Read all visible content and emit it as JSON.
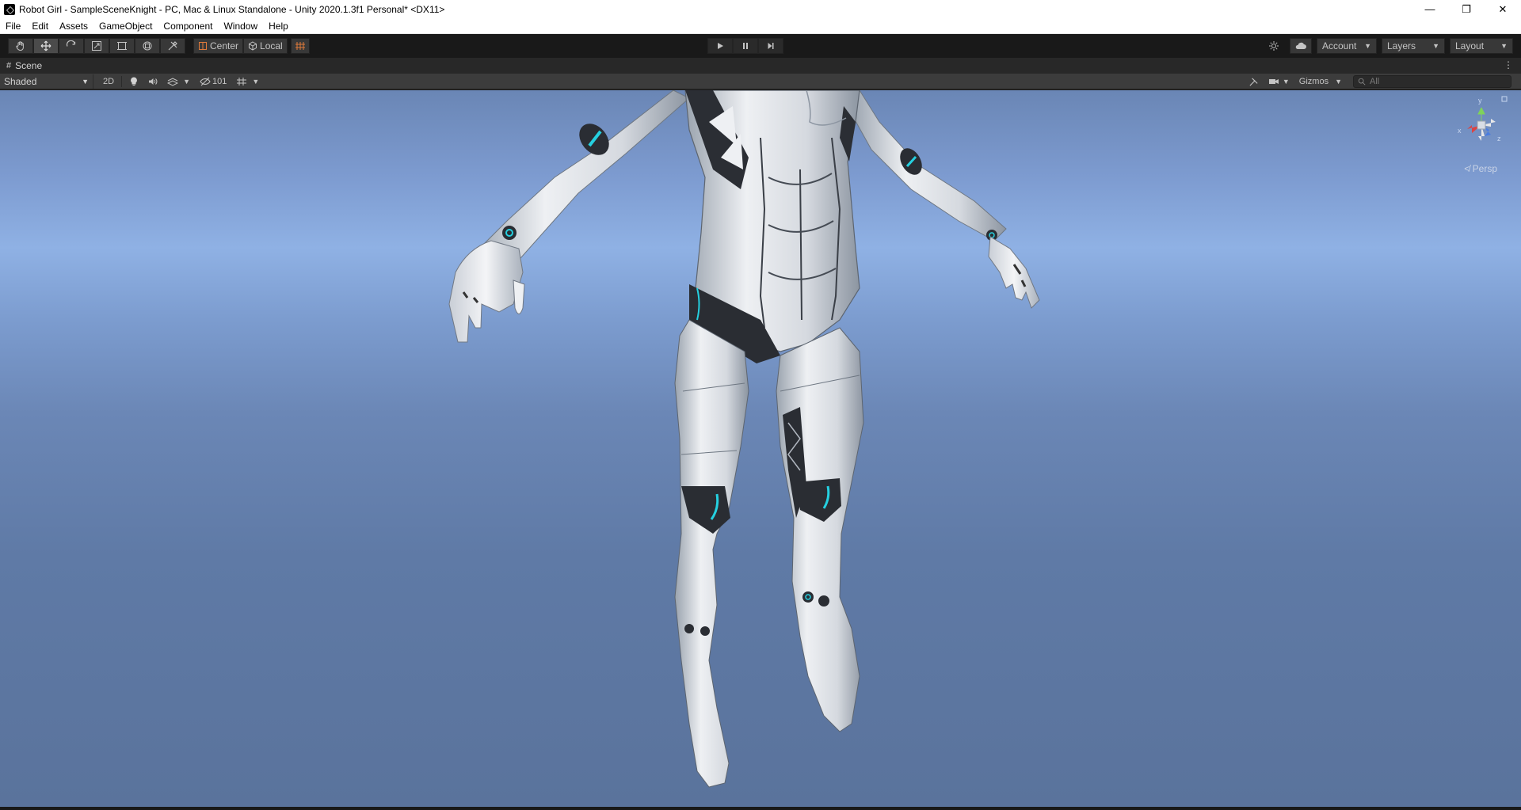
{
  "window": {
    "title": "Robot Girl - SampleSceneKnight - PC, Mac & Linux Standalone - Unity 2020.1.3f1 Personal* <DX11>",
    "controls": [
      "—",
      "❐",
      "✕"
    ]
  },
  "menu": [
    "File",
    "Edit",
    "Assets",
    "GameObject",
    "Component",
    "Window",
    "Help"
  ],
  "toolbar": {
    "tools": [
      "hand-icon",
      "move-icon",
      "rotate-icon",
      "scale-icon",
      "rect-icon",
      "transform-icon",
      "custom-tool-icon"
    ],
    "pivot_mode": "Center",
    "pivot_rotation": "Local",
    "account_label": "Account",
    "layers_label": "Layers",
    "layout_label": "Layout"
  },
  "scene_tab": {
    "label": "Scene"
  },
  "scene_toolbar": {
    "shading_mode": "Shaded",
    "mode_2d": "2D",
    "hidden_count": "101",
    "gizmos_label": "Gizmos",
    "search_placeholder": "All"
  },
  "viewport": {
    "projection_label": "≮ Persp",
    "axis_labels": {
      "x": "x",
      "y": "y",
      "z": "z"
    }
  },
  "colors": {
    "sky_top": "#8fb1e4",
    "sky_bottom": "#5a739c",
    "toolbar_bg": "#191919",
    "accent_cyan": "#25d0e0"
  }
}
